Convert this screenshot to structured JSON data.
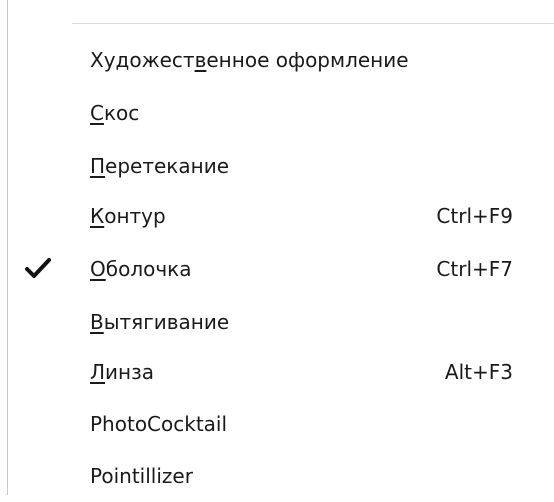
{
  "menu": {
    "items": [
      {
        "label": "Художественное оформление",
        "shortcut": "",
        "checked": false
      },
      {
        "label": "Скос",
        "shortcut": "",
        "checked": false
      },
      {
        "label": "Перетекание",
        "shortcut": "",
        "checked": false
      },
      {
        "label": "Контур",
        "shortcut": "Ctrl+F9",
        "checked": false
      },
      {
        "label": "Оболочка",
        "shortcut": "Ctrl+F7",
        "checked": true
      },
      {
        "label": "Вытягивание",
        "shortcut": "",
        "checked": false
      },
      {
        "label": "Линза",
        "shortcut": "Alt+F3",
        "checked": false
      },
      {
        "label": "PhotoCocktail",
        "shortcut": "",
        "checked": false
      },
      {
        "label": "Pointillizer",
        "shortcut": "",
        "checked": false
      }
    ]
  },
  "icons": {
    "checked": "checkmark-icon"
  },
  "colors": {
    "text": "#1a1a1a",
    "background": "#ffffff",
    "separator": "#d9d9d9"
  }
}
